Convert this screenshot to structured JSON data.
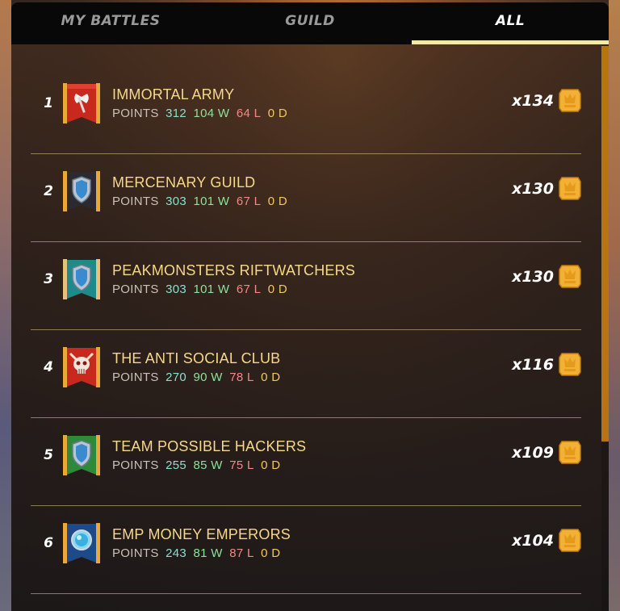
{
  "tabs": [
    {
      "label": "MY BATTLES",
      "active": false
    },
    {
      "label": "GUILD",
      "active": false
    },
    {
      "label": "ALL",
      "active": true
    }
  ],
  "colors": {
    "name": "#f5d889",
    "points": "#86e0cc",
    "wins": "#8de29a",
    "losses": "#f08a86",
    "draws": "#f2c85a",
    "tab_underline": "#f4e9a8",
    "scrollbar": "#b5760f"
  },
  "guilds": [
    {
      "rank": "1",
      "name": "IMMORTAL ARMY",
      "points_label": "POINTS",
      "points": "312",
      "wins": "104 W",
      "losses": "64 L",
      "draws": "0 D",
      "count": "x134",
      "banner": "red",
      "emblem": "axe-icon"
    },
    {
      "rank": "2",
      "name": "MERCENARY GUILD",
      "points_label": "POINTS",
      "points": "303",
      "wins": "101 W",
      "losses": "67 L",
      "draws": "0 D",
      "count": "x130",
      "banner": "dark",
      "emblem": "shield-icon"
    },
    {
      "rank": "3",
      "name": "PEAKMONSTERS RIFTWATCHERS",
      "points_label": "POINTS",
      "points": "303",
      "wins": "101 W",
      "losses": "67 L",
      "draws": "0 D",
      "count": "x130",
      "banner": "teal",
      "emblem": "shield-icon"
    },
    {
      "rank": "4",
      "name": "THE ANTI SOCIAL CLUB",
      "points_label": "POINTS",
      "points": "270",
      "wins": "90 W",
      "losses": "78 L",
      "draws": "0 D",
      "count": "x116",
      "banner": "red",
      "emblem": "skull-icon"
    },
    {
      "rank": "5",
      "name": "TEAM POSSIBLE HACKERS",
      "points_label": "POINTS",
      "points": "255",
      "wins": "85 W",
      "losses": "75 L",
      "draws": "0 D",
      "count": "x109",
      "banner": "green",
      "emblem": "shield-icon"
    },
    {
      "rank": "6",
      "name": "EMP MONEY EMPERORS",
      "points_label": "POINTS",
      "points": "243",
      "wins": "81 W",
      "losses": "87 L",
      "draws": "0 D",
      "count": "x104",
      "banner": "blue",
      "emblem": "orb-icon"
    }
  ]
}
